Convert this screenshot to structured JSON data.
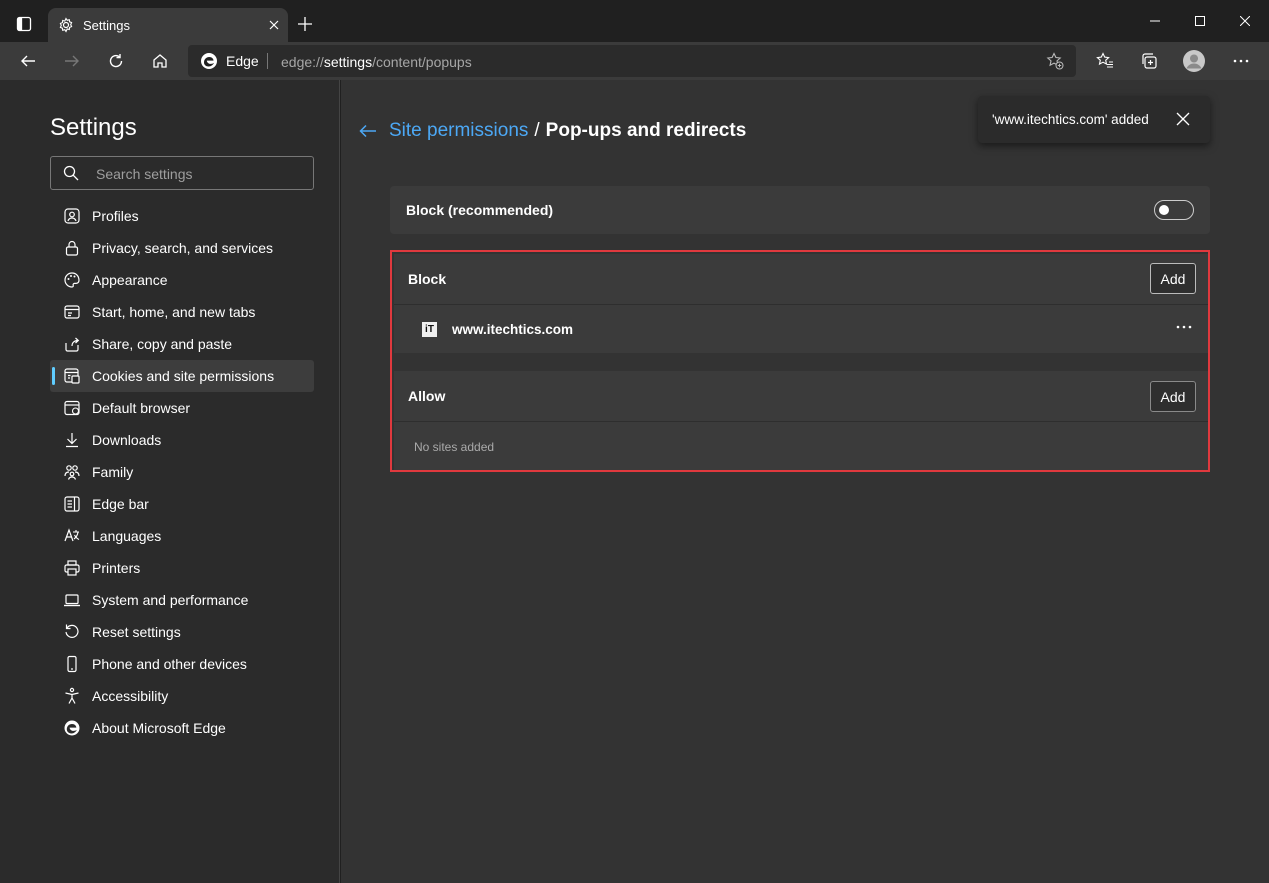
{
  "tab": {
    "title": "Settings"
  },
  "address": {
    "brand": "Edge",
    "url_prefix": "edge://",
    "url_bold": "settings",
    "url_rest": "/content/popups"
  },
  "sidebar": {
    "title": "Settings",
    "search_placeholder": "Search settings",
    "items": [
      {
        "label": "Profiles",
        "icon": "profile-icon"
      },
      {
        "label": "Privacy, search, and services",
        "icon": "lock-icon"
      },
      {
        "label": "Appearance",
        "icon": "palette-icon"
      },
      {
        "label": "Start, home, and new tabs",
        "icon": "home-tabs-icon"
      },
      {
        "label": "Share, copy and paste",
        "icon": "share-icon"
      },
      {
        "label": "Cookies and site permissions",
        "icon": "site-permissions-icon",
        "active": true
      },
      {
        "label": "Default browser",
        "icon": "browser-icon"
      },
      {
        "label": "Downloads",
        "icon": "download-icon"
      },
      {
        "label": "Family",
        "icon": "family-icon"
      },
      {
        "label": "Edge bar",
        "icon": "edge-bar-icon"
      },
      {
        "label": "Languages",
        "icon": "languages-icon"
      },
      {
        "label": "Printers",
        "icon": "printer-icon"
      },
      {
        "label": "System and performance",
        "icon": "laptop-icon"
      },
      {
        "label": "Reset settings",
        "icon": "reset-icon"
      },
      {
        "label": "Phone and other devices",
        "icon": "phone-icon"
      },
      {
        "label": "Accessibility",
        "icon": "accessibility-icon"
      },
      {
        "label": "About Microsoft Edge",
        "icon": "edge-logo-icon"
      }
    ]
  },
  "main": {
    "breadcrumb_link": "Site permissions",
    "breadcrumb_sep": "/",
    "breadcrumb_current": "Pop-ups and redirects",
    "toast": "'www.itechtics.com' added",
    "block_recommended": {
      "label": "Block (recommended)",
      "enabled": false
    },
    "block": {
      "label": "Block",
      "add": "Add",
      "sites": [
        "www.itechtics.com"
      ],
      "site_icon_text": "iT"
    },
    "allow": {
      "label": "Allow",
      "add": "Add",
      "empty": "No sites added"
    }
  },
  "colors": {
    "accent": "#4ca8f5",
    "highlight": "#e0393e"
  }
}
